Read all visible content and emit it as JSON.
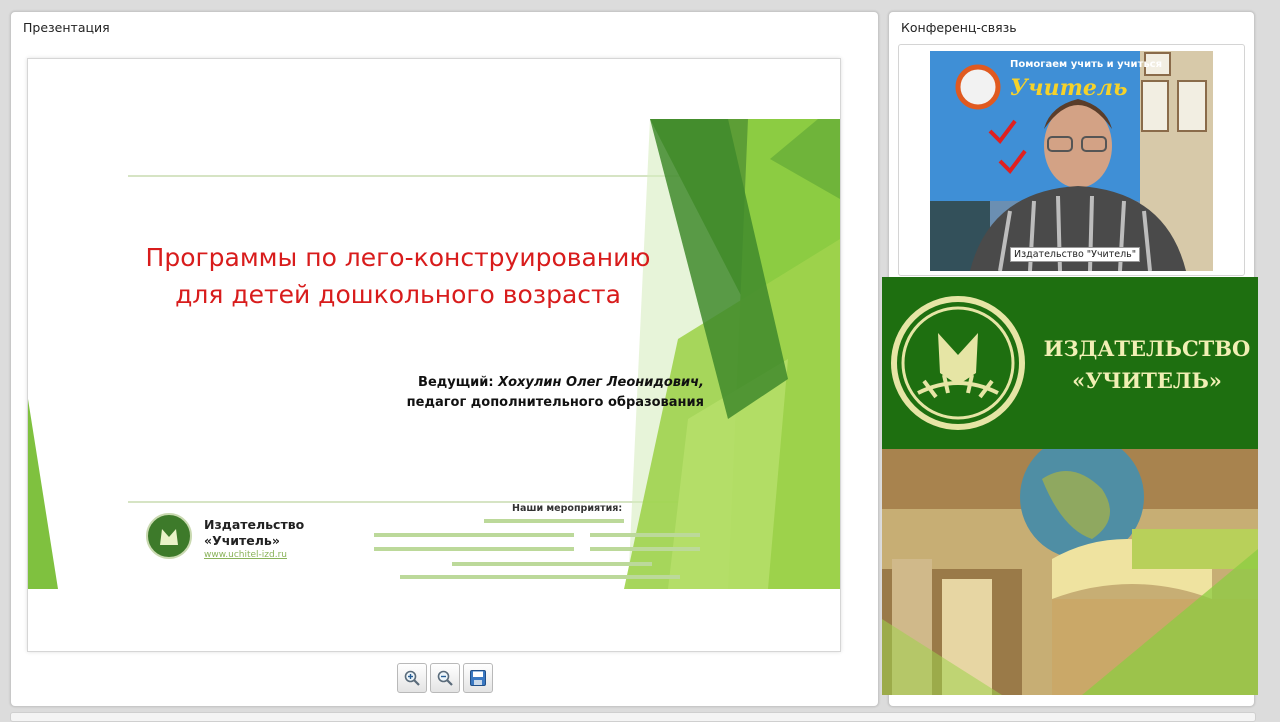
{
  "presentation": {
    "panel_title": "Презентация",
    "slide": {
      "title_line1": "Программы по лего-конструированию",
      "title_line2": "для детей дошкольного возраста",
      "presenter_label": "Ведущий:",
      "presenter_name": "Хохулин Олег Леонидович,",
      "presenter_role": "педагог дополнительного образования",
      "publisher_line1": "Издательство",
      "publisher_line2": "«Учитель»",
      "publisher_url": "www.uchitel-izd.ru",
      "events_title": "Наши мероприятия:",
      "title_color": "#d81c1c",
      "accent_green": "#7bbf3a"
    },
    "toolbar": {
      "zoom_in": "zoom-in-icon",
      "zoom_out": "zoom-out-icon",
      "save": "save-icon"
    }
  },
  "conference": {
    "panel_title": "Конференц-связь",
    "video_label": "Издательство \"Учитель\"",
    "video_bg_sign_line1": "Помогаем учить и учиться",
    "video_bg_sign_line2": "Учитель",
    "banner_line1": "ИЗДАТЕЛЬСТВО",
    "banner_line2": "«УЧИТЕЛЬ»",
    "banner_color": "#1e6f10",
    "banner_text_color": "#f1efb4"
  }
}
